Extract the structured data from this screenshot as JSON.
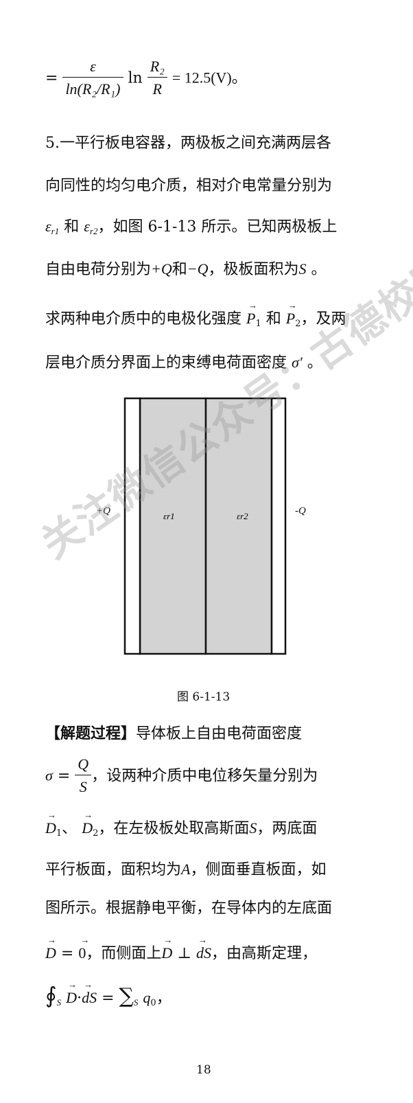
{
  "formula_top": {
    "eq": "=",
    "num": "ε",
    "den": "ln(R₂/R₁)",
    "ln": "ln",
    "frac2_num": "R₂",
    "frac2_den": "R",
    "result": "= 12.5(V)",
    "end": "。"
  },
  "problem": {
    "line1": "5.一平行板电容器，两极板之间充满两层各",
    "line2": "向同性的均匀电介质，相对介电常量分别为",
    "line3_a": "ε",
    "line3_sub1": "r1",
    "line3_mid": "和",
    "line3_b": "ε",
    "line3_sub2": "r2",
    "line3_end": "，如图 6-1-13 所示。已知两极板上",
    "line4_a": "自由电荷分别为",
    "line4_q1": "+Q",
    "line4_b": "和",
    "line4_q2": "−Q",
    "line4_c": "，极板面积为",
    "line4_s": "S",
    "line4_d": "。",
    "line5_a": "求两种电介质中的电极化强度",
    "line5_p1": "P",
    "line5_p1sub": "1",
    "line5_b": "和",
    "line5_p2": "P",
    "line5_p2sub": "2",
    "line5_c": "，及两",
    "line6_a": "层电介质分界面上的束缚电荷面密度",
    "line6_sigma": "σ′",
    "line6_end": "。"
  },
  "figure": {
    "left_label": "+Q",
    "right_label": "-Q",
    "eps1": "εr1",
    "eps2": "εr2",
    "fill_color": "#d3d3d3",
    "caption": "图 6-1-13"
  },
  "watermark": "关注微信公众号：古德校园",
  "solution": {
    "heading": "【解题过程】",
    "line1_rest": "导体板上自由电荷面密度",
    "sigma": "σ",
    "eq": "=",
    "frac_num": "Q",
    "frac_den": "S",
    "line2_rest": "，设两种介质中电位移矢量分别为",
    "d1": "D",
    "d1sub": "1",
    "sep": "、",
    "d2": "D",
    "d2sub": "2",
    "line3_mid": "，在左极板处取高斯面",
    "line3_s": "S",
    "line3_end": "，两底面",
    "line4_a": "平行板面，面积均为",
    "line4_A": "A",
    "line4_b": "，侧面垂直板面，如",
    "line5": "图所示。根据静电平衡，在导体内的左底面",
    "line6_D": "D",
    "line6_eq": "=",
    "line6_zero": "0",
    "line6_mid": "，而侧面上",
    "line6_D2": "D",
    "line6_perp": "⊥",
    "line6_dS": "dS",
    "line6_end": "，由高斯定理，",
    "line7_oint": "∮",
    "line7_s": "S",
    "line7_D": "D",
    "line7_dot": "·",
    "line7_dS": "dS",
    "line7_eq": "=",
    "line7_sum": "∑",
    "line7_sumsub": "S",
    "line7_q": "q",
    "line7_qsub": "0",
    "line7_end": "，"
  },
  "page_number": "18"
}
